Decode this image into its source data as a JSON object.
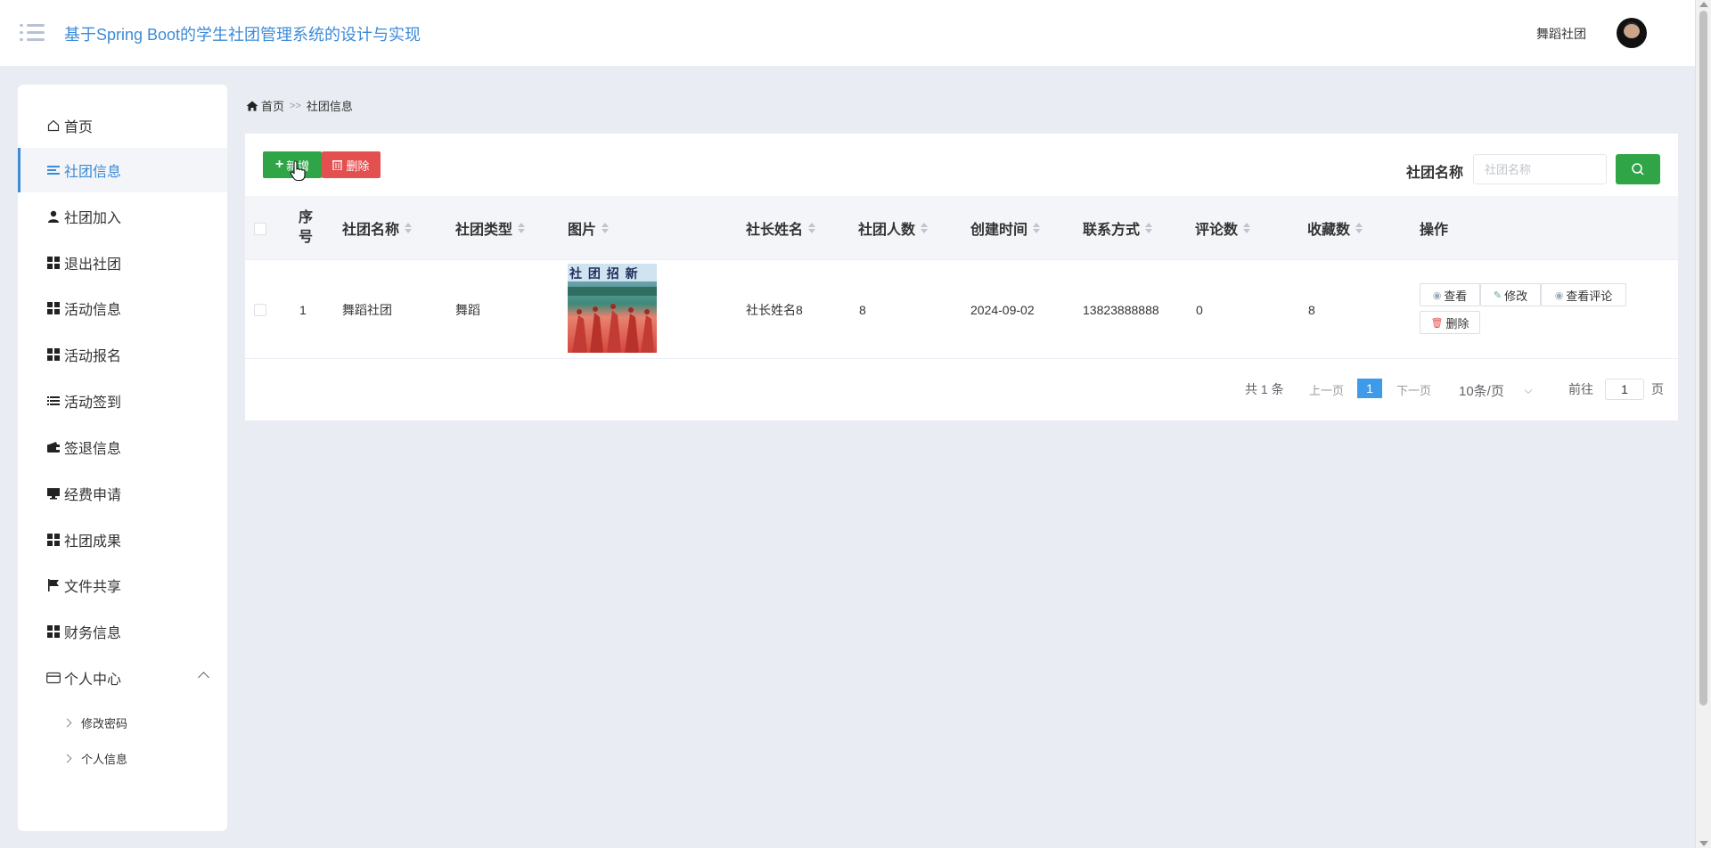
{
  "header": {
    "title": "基于Spring Boot的学生社团管理系统的设计与实现",
    "user_name": "舞蹈社团"
  },
  "sidebar": {
    "items": [
      {
        "label": "首页",
        "icon": "home-icon"
      },
      {
        "label": "社团信息",
        "icon": "list-icon",
        "active": true
      },
      {
        "label": "社团加入",
        "icon": "user-icon"
      },
      {
        "label": "退出社团",
        "icon": "grid-icon"
      },
      {
        "label": "活动信息",
        "icon": "grid-icon"
      },
      {
        "label": "活动报名",
        "icon": "grid-icon"
      },
      {
        "label": "活动签到",
        "icon": "list-icon"
      },
      {
        "label": "签退信息",
        "icon": "wallet-icon"
      },
      {
        "label": "经费申请",
        "icon": "monitor-icon"
      },
      {
        "label": "社团成果",
        "icon": "grid-icon"
      },
      {
        "label": "文件共享",
        "icon": "flag-icon"
      },
      {
        "label": "财务信息",
        "icon": "grid-icon"
      },
      {
        "label": "个人中心",
        "icon": "card-icon"
      }
    ],
    "sub_items": [
      {
        "label": "修改密码"
      },
      {
        "label": "个人信息"
      }
    ]
  },
  "breadcrumb": {
    "home": "首页",
    "separator": ">>",
    "current": "社团信息"
  },
  "toolbar": {
    "add_label": "新增",
    "delete_label": "删除",
    "search_label": "社团名称",
    "search_placeholder": "社团名称",
    "search_value": ""
  },
  "table": {
    "headers": {
      "index": "序号",
      "name": "社团名称",
      "type": "社团类型",
      "image": "图片",
      "leader": "社长姓名",
      "members": "社团人数",
      "created": "创建时间",
      "contact": "联系方式",
      "comments": "评论数",
      "favorites": "收藏数",
      "actions": "操作"
    },
    "rows": [
      {
        "index": "1",
        "name": "舞蹈社团",
        "type": "舞蹈",
        "image_text": "社 团 招 新",
        "leader": "社长姓名8",
        "members": "8",
        "created": "2024-09-02",
        "contact": "13823888888",
        "comments": "0",
        "favorites": "8"
      }
    ],
    "actions": {
      "view": "查看",
      "edit": "修改",
      "view_comments": "查看评论",
      "delete": "删除"
    }
  },
  "pagination": {
    "total_label": "共 1 条",
    "prev_label": "上一页",
    "current_page": "1",
    "next_label": "下一页",
    "page_size": "10条/页",
    "goto_prefix": "前往",
    "goto_value": "1",
    "goto_suffix": "页"
  },
  "colors": {
    "accent": "#3d8bd6",
    "add_button": "#2fa548",
    "delete_button": "#e44f4f",
    "search_button": "#2fa548",
    "page_active": "#3d9be9"
  }
}
